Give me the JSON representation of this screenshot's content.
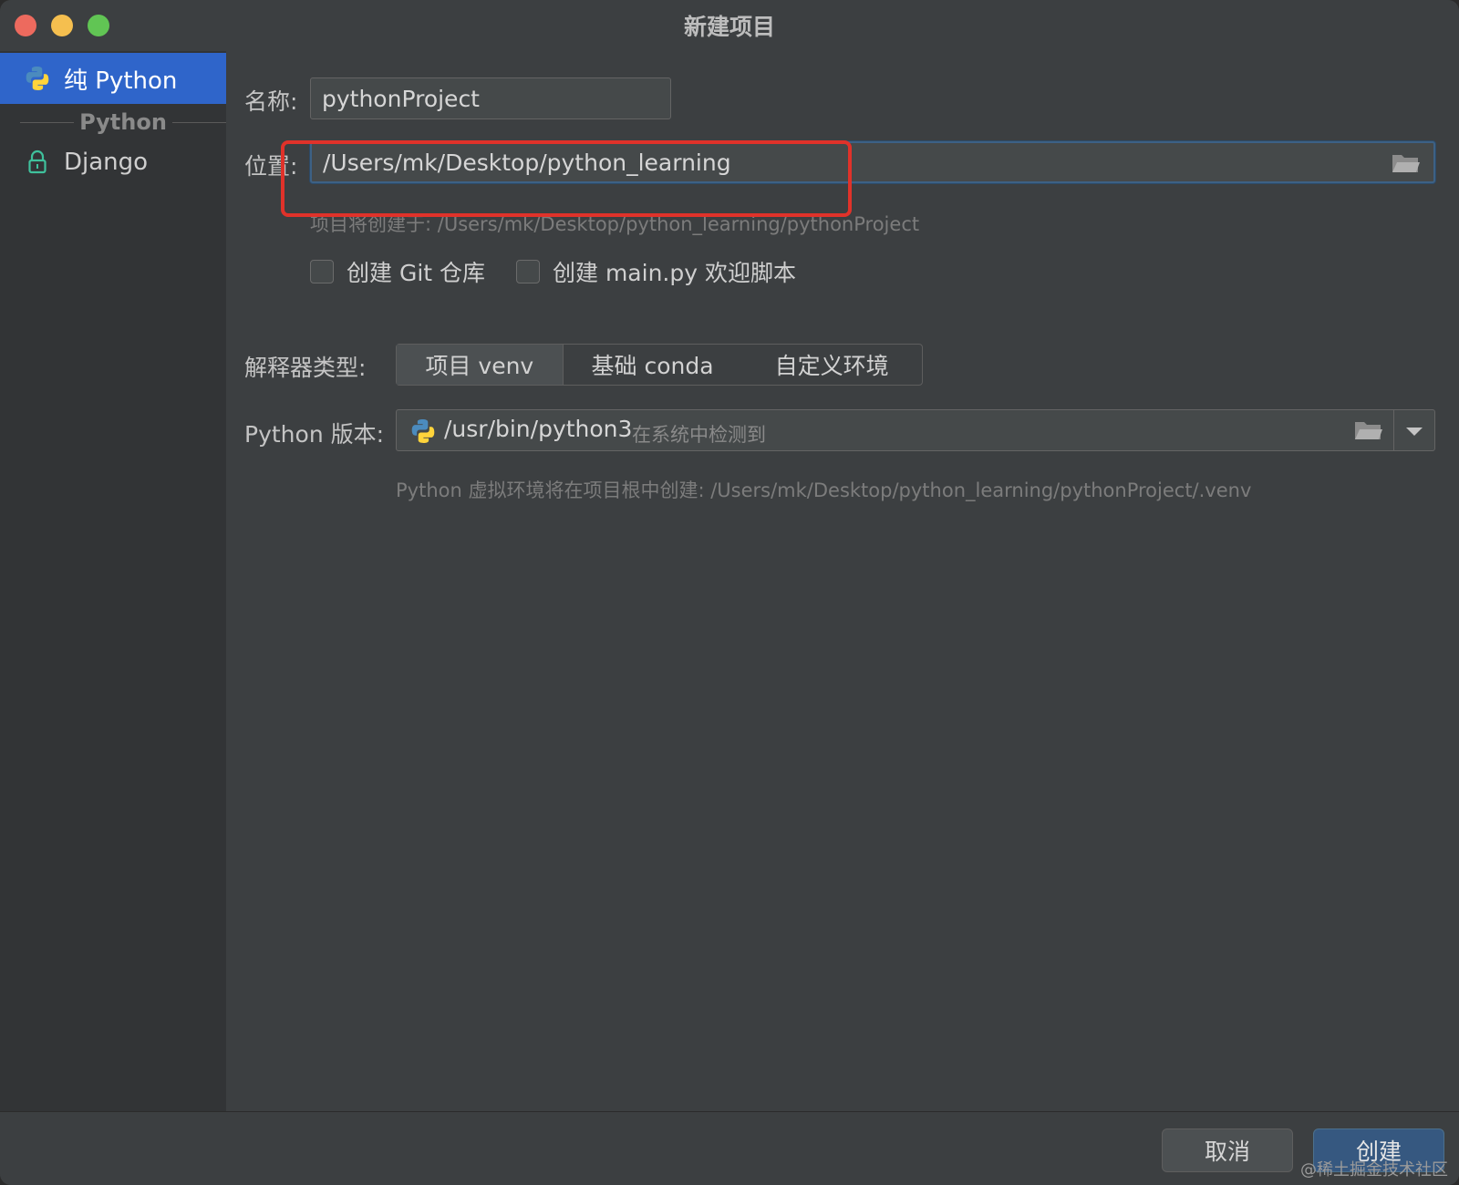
{
  "window": {
    "title": "新建项目"
  },
  "sidebar": {
    "items": [
      {
        "label": "纯 Python",
        "icon": "python-icon",
        "selected": true
      },
      {
        "label": "Django",
        "icon": "lock-icon",
        "selected": false
      }
    ],
    "group_label": "Python"
  },
  "form": {
    "name_label": "名称:",
    "name_value": "pythonProject",
    "location_label": "位置:",
    "location_value": "/Users/mk/Desktop/python_learning",
    "location_hint": "项目将创建于: /Users/mk/Desktop/python_learning/pythonProject",
    "git_checkbox_label": "创建 Git 仓库",
    "main_checkbox_label": "创建 main.py 欢迎脚本",
    "interpreter_label": "解释器类型:",
    "interpreter_options": [
      "项目 venv",
      "基础 conda",
      "自定义环境"
    ],
    "interpreter_selected": "项目 venv",
    "python_version_label": "Python 版本:",
    "python_version_path": "/usr/bin/python3",
    "python_version_detected": "在系统中检测到",
    "venv_hint": "Python 虚拟环境将在项目根中创建: /Users/mk/Desktop/python_learning/pythonProject/.venv"
  },
  "footer": {
    "cancel_label": "取消",
    "create_label": "创建",
    "watermark": "@稀土掘金技术社区"
  },
  "colors": {
    "accent": "#2f65ca",
    "highlight": "#e0322a"
  }
}
